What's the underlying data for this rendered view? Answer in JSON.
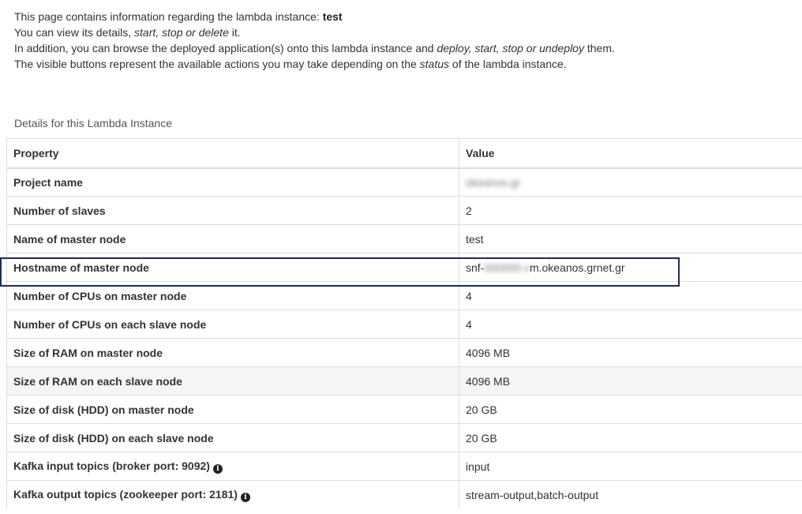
{
  "intro": {
    "line1_prefix": "This page contains information regarding the lambda instance: ",
    "instance_name": "test",
    "line2_prefix": "You can view its details, ",
    "line2_actions": "start, stop or delete",
    "line2_suffix": " it.",
    "line3_prefix": "In addition, you can browse the deployed application(s) onto this lambda instance and ",
    "line3_actions": "deploy, start, stop or undeploy",
    "line3_suffix": " them.",
    "line4_prefix": "The visible buttons represent the available actions you may take depending on the ",
    "line4_status": "status",
    "line4_suffix": " of the lambda instance."
  },
  "details": {
    "caption": "Details for this Lambda Instance",
    "headers": {
      "property": "Property",
      "value": "Value"
    },
    "rows": [
      {
        "property": "Project name",
        "value": "okeanos.gr"
      },
      {
        "property": "Number of slaves",
        "value": "2"
      },
      {
        "property": "Name of master node",
        "value": "test"
      },
      {
        "property": "Hostname of master node",
        "value_prefix": "snf-",
        "value_hidden": "000000.v",
        "value_suffix": "m.okeanos.grnet.gr"
      },
      {
        "property": "Number of CPUs on master node",
        "value": "4"
      },
      {
        "property": "Number of CPUs on each slave node",
        "value": "4"
      },
      {
        "property": "Size of RAM on master node",
        "value": "4096 MB"
      },
      {
        "property": "Size of RAM on each slave node",
        "value": "4096 MB"
      },
      {
        "property": "Size of disk (HDD) on master node",
        "value": "20 GB"
      },
      {
        "property": "Size of disk (HDD) on each slave node",
        "value": "20 GB"
      },
      {
        "property": "Kafka input topics (broker port: 9092)",
        "value": "input",
        "icon": "info-icon"
      },
      {
        "property": "Kafka output topics (zookeeper port: 2181)",
        "value": "stream-output,batch-output",
        "icon": "info-icon"
      }
    ]
  },
  "colors": {
    "highlight_border": "#1f2a5a",
    "stripe": "#f5f5f5",
    "grid": "#dddddd"
  }
}
